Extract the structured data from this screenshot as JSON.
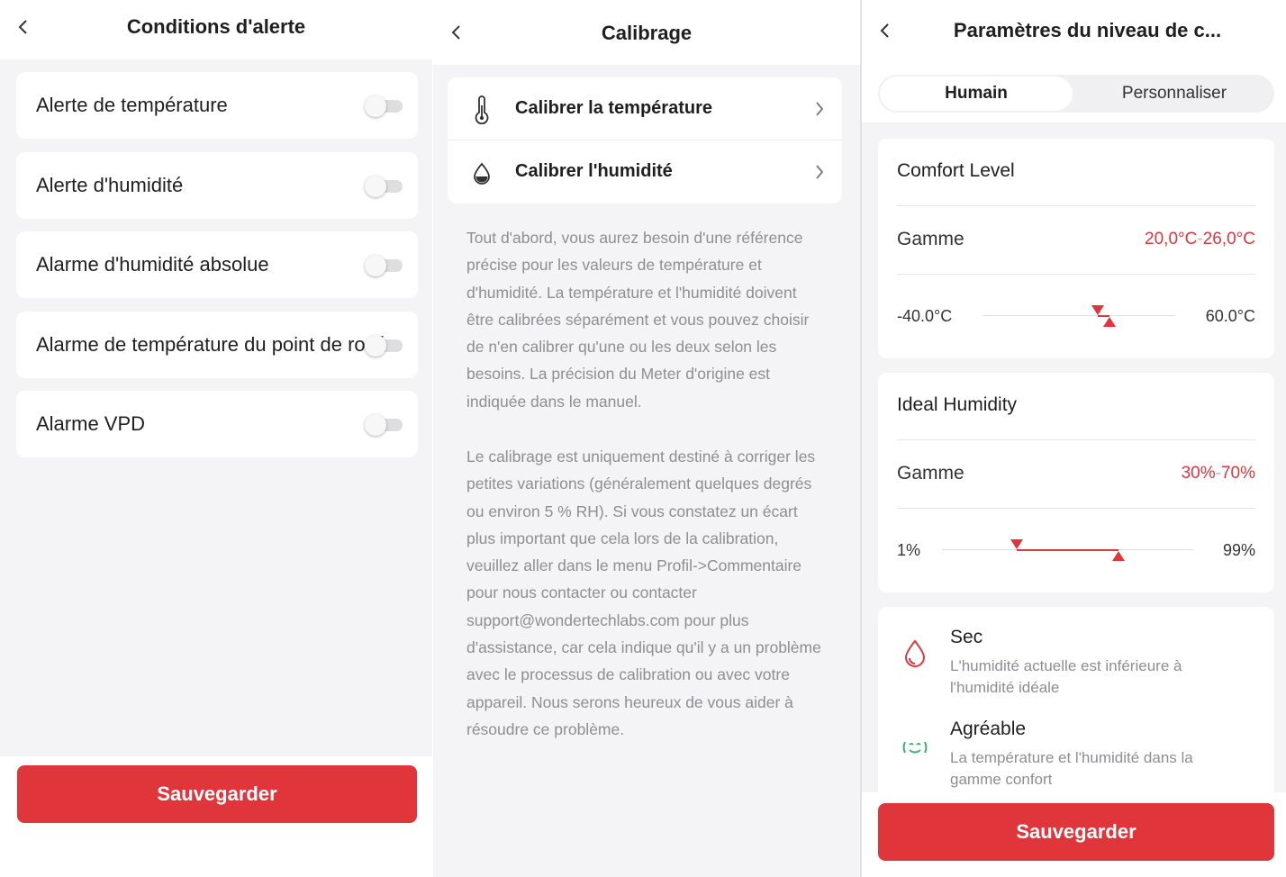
{
  "alert_conditions": {
    "title": "Conditions d'alerte",
    "items": [
      {
        "label": "Alerte de température",
        "enabled": false
      },
      {
        "label": "Alerte d'humidité",
        "enabled": false
      },
      {
        "label": "Alarme d'humidité absolue",
        "enabled": false
      },
      {
        "label": "Alarme de température du point de rosée",
        "enabled": false
      },
      {
        "label": "Alarme VPD",
        "enabled": false
      }
    ],
    "save_label": "Sauvegarder"
  },
  "calibration": {
    "title": "Calibrage",
    "rows": [
      {
        "label": "Calibrer la température",
        "icon": "thermometer-icon"
      },
      {
        "label": "Calibrer l'humidité",
        "icon": "water-drop-icon"
      }
    ],
    "paragraph1": "Tout d'abord, vous aurez besoin d'une référence précise pour les valeurs de température et d'humidité. La température et l'humidité doivent être calibrées séparément et vous pouvez choisir de n'en calibrer qu'une ou les deux selon les besoins. La précision du Meter d'origine est indiquée dans le manuel.",
    "paragraph2": "Le calibrage est uniquement destiné à corriger les petites variations (généralement quelques degrés ou environ 5 % RH). Si vous constatez un écart plus important que cela lors de la calibration, veuillez aller dans le menu Profil->Commentaire pour nous contacter ou contacter support@wondertechlabs.com pour plus d'assistance, car cela indique qu'il y a un problème avec le processus de calibration ou avec votre appareil. Nous serons heureux de vous aider à résoudre ce problème."
  },
  "comfort_settings": {
    "title": "Paramètres du niveau de c...",
    "tabs": [
      {
        "label": "Humain",
        "active": true
      },
      {
        "label": "Personnaliser",
        "active": false
      }
    ],
    "comfort_level": {
      "title": "Comfort Level",
      "range_label": "Gamme",
      "range_low": "20,0°C",
      "range_sep": "-",
      "range_high": "26,0°C",
      "scale_min": "-40.0°C",
      "scale_max": "60.0°C",
      "min_value": -40,
      "max_value": 60,
      "low_value": 20,
      "high_value": 26
    },
    "ideal_humidity": {
      "title": "Ideal Humidity",
      "range_label": "Gamme",
      "range_low": "30%",
      "range_sep": "-",
      "range_high": "70%",
      "scale_min": "1%",
      "scale_max": "99%",
      "min_value": 1,
      "max_value": 99,
      "low_value": 30,
      "high_value": 70
    },
    "legend": [
      {
        "title": "Sec",
        "desc": "L'humidité actuelle est inférieure à l'humidité idéale",
        "icon": "dry-drop-icon"
      },
      {
        "title": "Agréable",
        "desc": "La température et l'humidité dans la gamme confort",
        "icon": "smiley-icon"
      }
    ],
    "save_label": "Sauvegarder"
  },
  "colors": {
    "accent": "#e0353a",
    "background": "#f4f4f6",
    "card": "#ffffff",
    "muted_text": "#8e8e93",
    "comfort_green": "#3bb273"
  }
}
